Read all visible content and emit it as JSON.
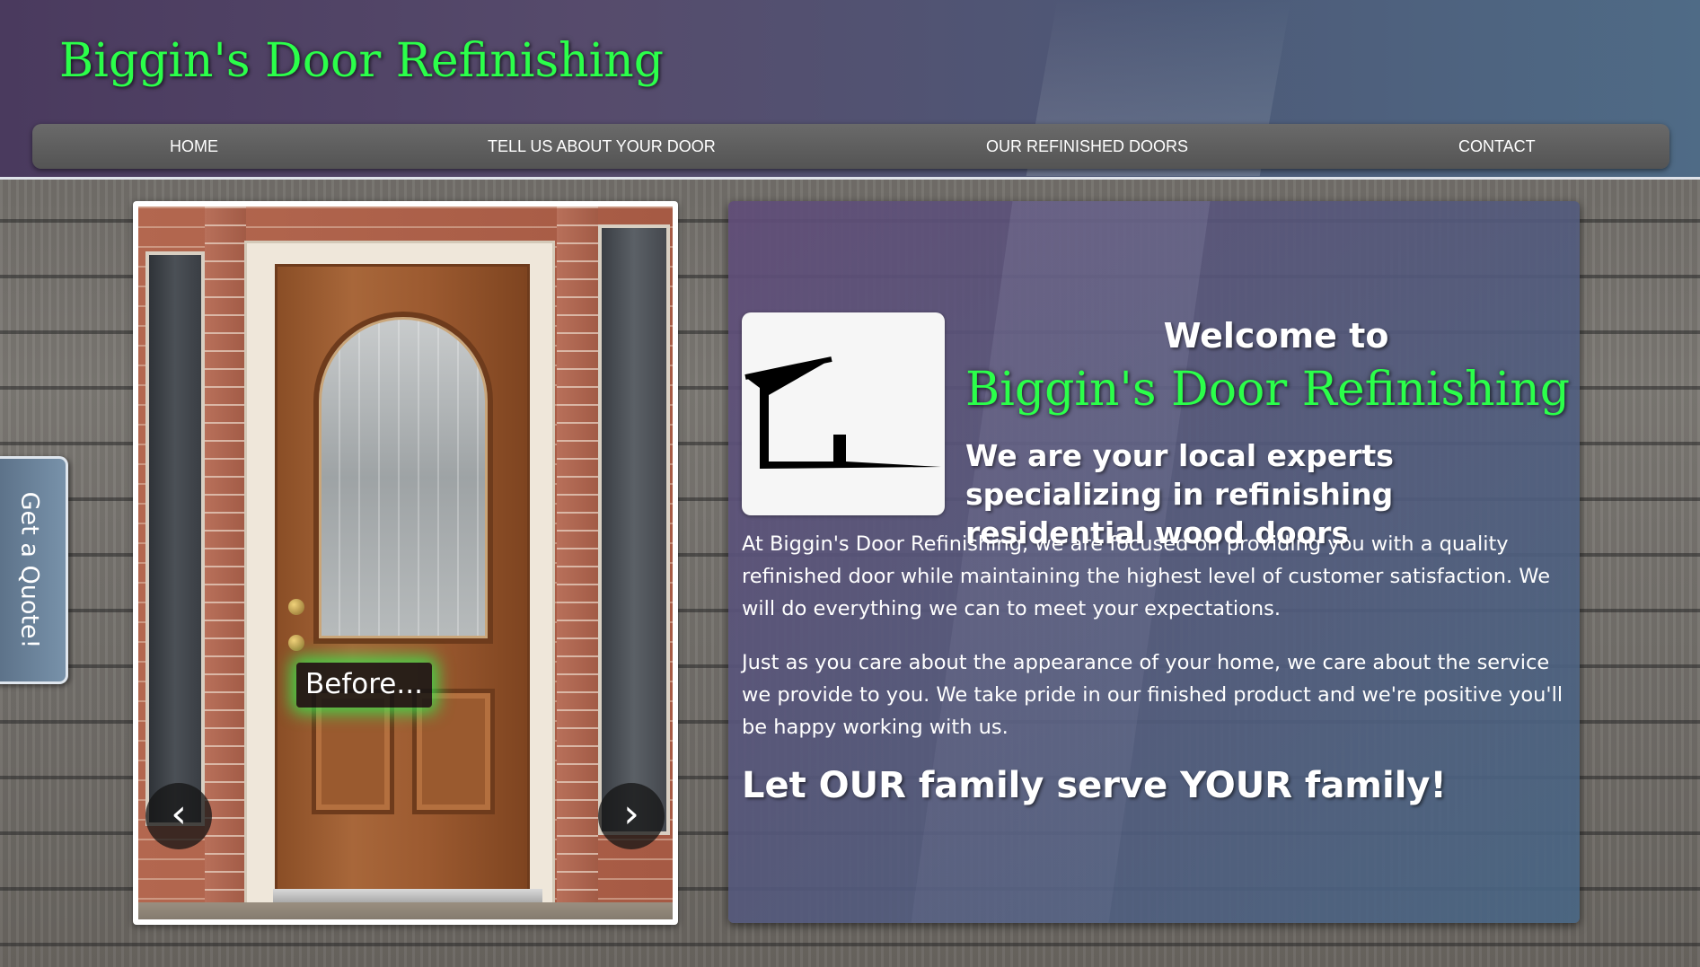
{
  "header": {
    "site_title": "Biggin's Door Refinishing",
    "title_color": "#2bff4a"
  },
  "nav": {
    "items": [
      {
        "label": "HOME"
      },
      {
        "label": "TELL US ABOUT YOUR DOOR"
      },
      {
        "label": "OUR REFINISHED DOORS"
      },
      {
        "label": "CONTACT"
      }
    ]
  },
  "slider": {
    "caption": "Before...",
    "prev_icon": "chevron-left-icon",
    "next_icon": "chevron-right-icon",
    "prev_glyph": "‹",
    "next_glyph": "›"
  },
  "quote_tab": {
    "label": "Get a Quote!"
  },
  "welcome": {
    "heading": "Welcome to",
    "brand": "Biggin's Door Refinishing",
    "tagline": "We are your local experts specializing in refinishing residential wood doors",
    "paragraph_1": "At Biggin's Door Refinishing, we are focused on providing you with a quality refinished door while maintaining the highest level of customer satisfaction. We will do everything we can to meet your expectations.",
    "paragraph_2": "Just as you care about the appearance of your home, we care about the service we provide to you. We take pride in our finished product and we're positive you'll be happy working with us.",
    "slogan": "Let OUR family serve YOUR family!",
    "logo_icon": "house-outline-logo"
  }
}
